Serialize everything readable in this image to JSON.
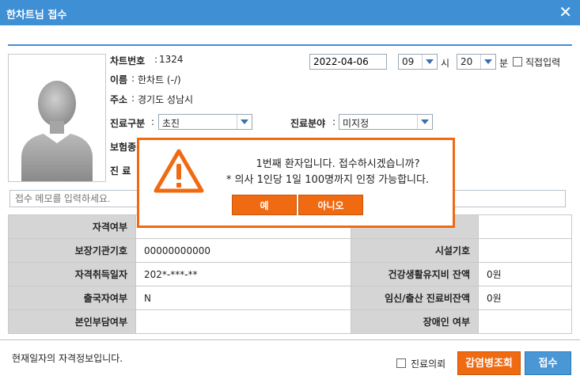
{
  "window": {
    "title": "한차트님 접수"
  },
  "patient": {
    "chart_no_label": "차트번호",
    "chart_no": "1324",
    "name_label": "이름",
    "name": "한차트 (-/)",
    "address_label": "주소",
    "address": "경기도 성남시",
    "visit_type_label": "진료구분",
    "visit_type": "초진",
    "dept_label": "진료분야",
    "dept": "미지정",
    "insurance_label": "보험종",
    "doctor_label": "진 료"
  },
  "datetime": {
    "date": "2022-04-06",
    "hour": "09",
    "hour_unit": "시",
    "minute": "20",
    "minute_unit": "분",
    "manual_label": "직접입력"
  },
  "memo": {
    "placeholder": "접수 메모를 입력하세요."
  },
  "table": {
    "rows": [
      {
        "h1": "자격여부",
        "v1": "",
        "h2": "",
        "v2": ""
      },
      {
        "h1": "보장기관기호",
        "v1": "00000000000",
        "h2": "시설기호",
        "v2": ""
      },
      {
        "h1": "자격취득일자",
        "v1": "202*-***-**",
        "h2": "건강생활유지비 잔액",
        "v2": "0원"
      },
      {
        "h1": "출국자여부",
        "v1": "N",
        "h2": "임신/출산 진료비잔액",
        "v2": "0원"
      },
      {
        "h1": "본인부담여부",
        "v1": "",
        "h2": "장애인 여부",
        "v2": ""
      }
    ]
  },
  "footer": {
    "note": "현재일자의 자격정보입니다.",
    "referral_label": "진료의뢰",
    "infection_button": "감염병조회",
    "submit_button": "접수"
  },
  "dialog": {
    "line1": "1번째 환자입니다. 접수하시겠습니까?",
    "line2": "* 의사 1인당 1일 100명까지 인정 가능합니다.",
    "yes": "예",
    "no": "아니오"
  },
  "colors": {
    "titlebar": "#3f8fd5",
    "accent_orange": "#f06a12",
    "submit_blue": "#4a97d6"
  }
}
